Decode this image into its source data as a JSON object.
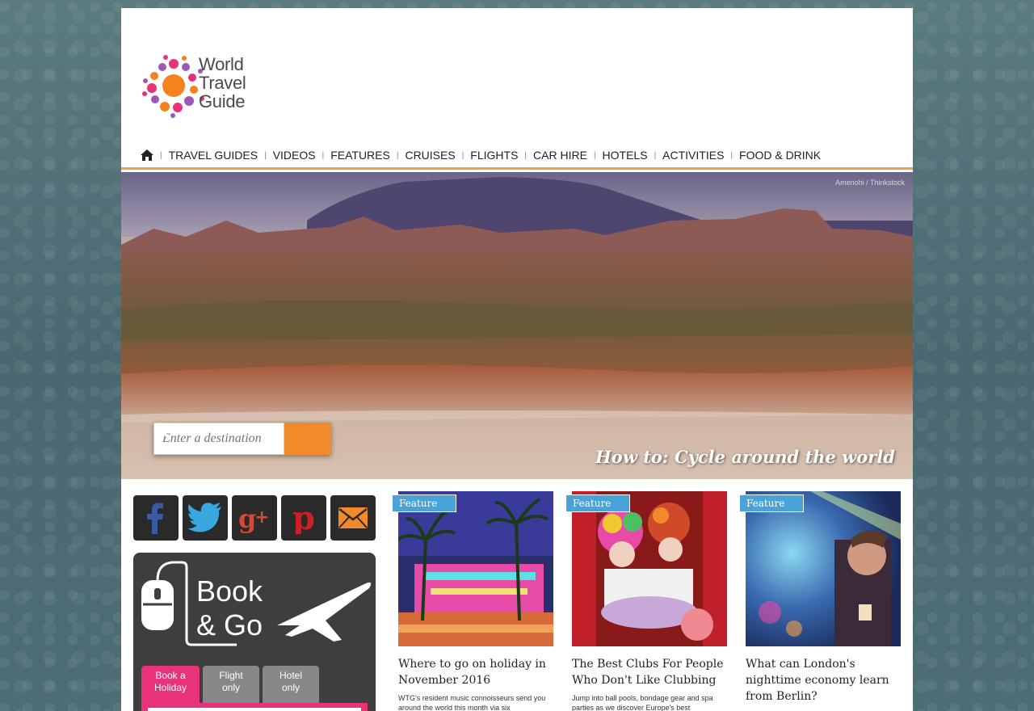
{
  "logo": {
    "line1": "World",
    "line2": "Travel",
    "line3": "Guide"
  },
  "nav": {
    "items": [
      "TRAVEL GUIDES",
      "VIDEOS",
      "FEATURES",
      "CRUISES",
      "FLIGHTS",
      "CAR HIRE",
      "HOTELS",
      "ACTIVITIES",
      "FOOD & DRINK"
    ]
  },
  "hero": {
    "credit": "Amenohi / Thinkstock",
    "search_placeholder": "Enter a destination",
    "caption": "How to: Cycle around the world"
  },
  "social": [
    "facebook-icon",
    "twitter-icon",
    "google-plus-icon",
    "pinterest-icon",
    "email-icon"
  ],
  "book": {
    "line1": "Book",
    "line2": "& Go",
    "tabs": [
      {
        "l1": "Book a",
        "l2": "Holiday"
      },
      {
        "l1": "Flight",
        "l2": "only"
      },
      {
        "l1": "Hotel",
        "l2": "only"
      }
    ]
  },
  "cards": [
    {
      "tag": "Feature",
      "title": "Where to go on holiday in November 2016",
      "desc": "WTG's resident music connoisseurs send you around the world this month via six"
    },
    {
      "tag": "Feature",
      "title": "The Best Clubs For People Who Don't Like Clubbing",
      "desc": "Jump into ball pools, bondage gear and spa parties as we discover Europe's best"
    },
    {
      "tag": "Feature",
      "title": "What can London's nighttime economy learn from Berlin?",
      "desc": ""
    }
  ],
  "colors": {
    "accent": "#f08a2a",
    "feature_tag": "#4aa3d8",
    "book_pink": "#e8327a"
  }
}
